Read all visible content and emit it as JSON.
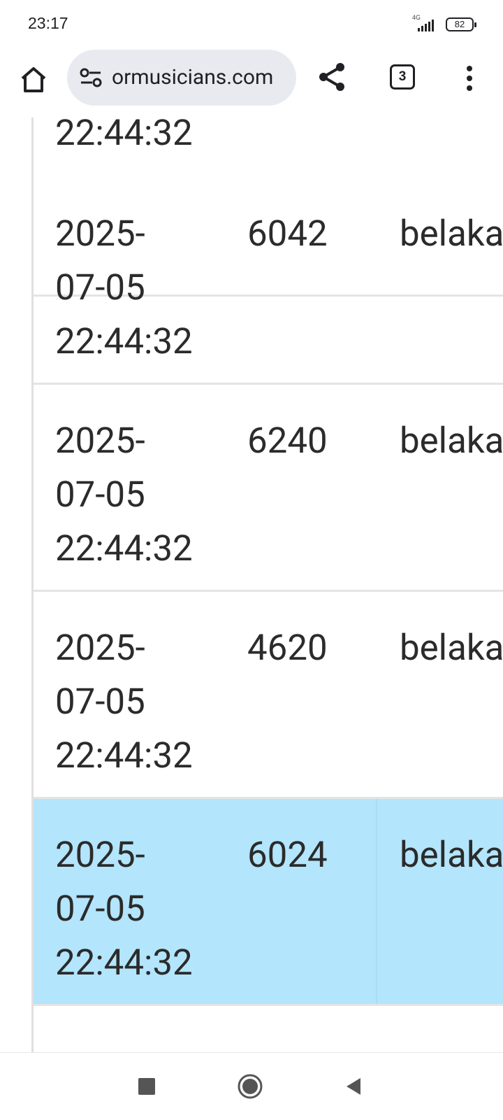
{
  "status_bar": {
    "time": "23:17",
    "network_label": "4G",
    "battery_level": "82"
  },
  "toolbar": {
    "url": "ormusicians.com",
    "tab_count": "3"
  },
  "table": {
    "partial_top_time": "22:44:32",
    "rows": [
      {
        "date": "2025-",
        "date2": "07-05",
        "time": "22:44:32",
        "number": "6042",
        "user": "belaka",
        "highlighted": false
      },
      {
        "date": "2025-",
        "date2": "07-05",
        "time": "22:44:32",
        "number": "6240",
        "user": "belaka",
        "highlighted": false
      },
      {
        "date": "2025-",
        "date2": "07-05",
        "time": "22:44:32",
        "number": "4620",
        "user": "belaka",
        "highlighted": false
      },
      {
        "date": "2025-",
        "date2": "07-05",
        "time": "22:44:32",
        "number": "6024",
        "user": "belaka",
        "highlighted": true
      }
    ]
  },
  "colors": {
    "highlight_row": "#b3e5fc",
    "omnibox_bg": "#e8eaf0"
  }
}
